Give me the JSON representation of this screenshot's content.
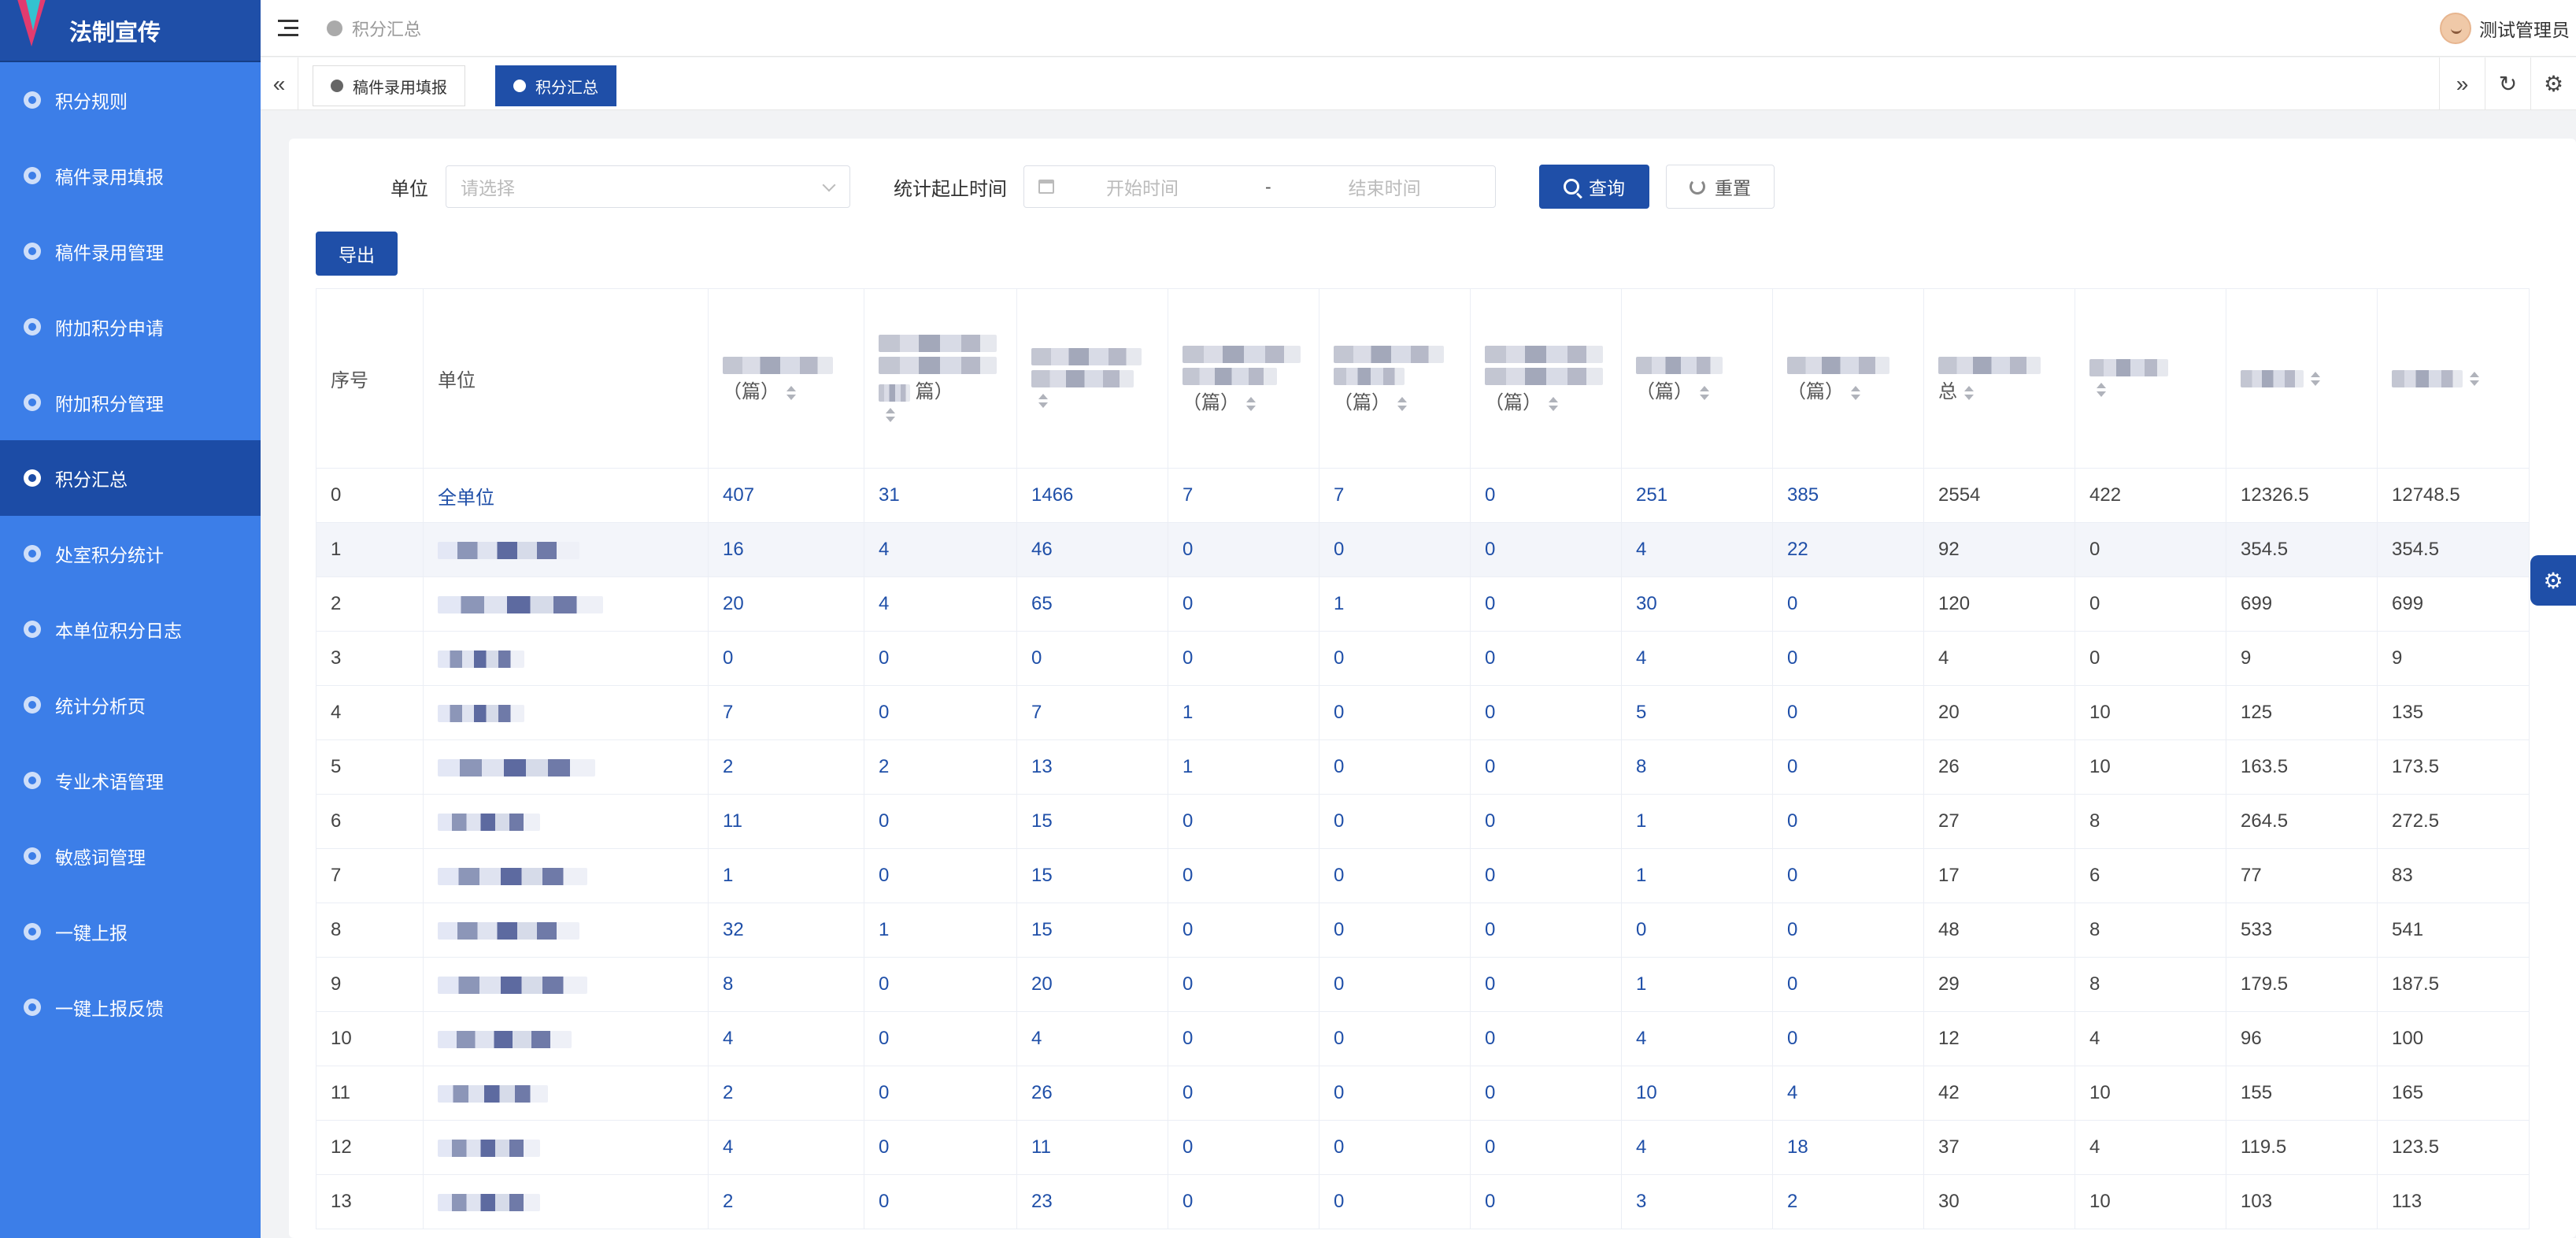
{
  "app": {
    "title": "法制宣传"
  },
  "sidebar": {
    "items": [
      {
        "label": "积分规则",
        "active": false
      },
      {
        "label": "稿件录用填报",
        "active": false
      },
      {
        "label": "稿件录用管理",
        "active": false
      },
      {
        "label": "附加积分申请",
        "active": false
      },
      {
        "label": "附加积分管理",
        "active": false
      },
      {
        "label": "积分汇总",
        "active": true
      },
      {
        "label": "处室积分统计",
        "active": false
      },
      {
        "label": "本单位积分日志",
        "active": false
      },
      {
        "label": "统计分析页",
        "active": false
      },
      {
        "label": "专业术语管理",
        "active": false
      },
      {
        "label": "敏感词管理",
        "active": false
      },
      {
        "label": "一键上报",
        "active": false
      },
      {
        "label": "一键上报反馈",
        "active": false
      }
    ]
  },
  "header": {
    "breadcrumb": "积分汇总",
    "user_name": "测试管理员"
  },
  "tabs": [
    {
      "label": "稿件录用填报",
      "active": false
    },
    {
      "label": "积分汇总",
      "active": true
    }
  ],
  "filters": {
    "unit_label": "单位",
    "unit_placeholder": "请选择",
    "date_label": "统计起止时间",
    "start_placeholder": "开始时间",
    "separator": "-",
    "end_placeholder": "结束时间",
    "query_label": "查询",
    "reset_label": "重置",
    "export_label": "导出"
  },
  "table": {
    "headers": {
      "index": "序号",
      "unit": "单位",
      "c1": "（篇）",
      "c2": "篇）",
      "c4": "（篇）",
      "c5": "（篇）",
      "c6": "（篇）",
      "c7": "（篇）",
      "c8": "（篇）",
      "c9": "总"
    },
    "rows": [
      {
        "idx": "0",
        "unit": "全单位",
        "v": [
          "407",
          "31",
          "1466",
          "7",
          "7",
          "0",
          "251",
          "385",
          "2554",
          "422",
          "12326.5",
          "12748.5"
        ]
      },
      {
        "idx": "1",
        "unit": "",
        "v": [
          "16",
          "4",
          "46",
          "0",
          "0",
          "0",
          "4",
          "22",
          "92",
          "0",
          "354.5",
          "354.5"
        ]
      },
      {
        "idx": "2",
        "unit": "",
        "v": [
          "20",
          "4",
          "65",
          "0",
          "1",
          "0",
          "30",
          "0",
          "120",
          "0",
          "699",
          "699"
        ]
      },
      {
        "idx": "3",
        "unit": "",
        "v": [
          "0",
          "0",
          "0",
          "0",
          "0",
          "0",
          "4",
          "0",
          "4",
          "0",
          "9",
          "9"
        ]
      },
      {
        "idx": "4",
        "unit": "",
        "v": [
          "7",
          "0",
          "7",
          "1",
          "0",
          "0",
          "5",
          "0",
          "20",
          "10",
          "125",
          "135"
        ]
      },
      {
        "idx": "5",
        "unit": "",
        "v": [
          "2",
          "2",
          "13",
          "1",
          "0",
          "0",
          "8",
          "0",
          "26",
          "10",
          "163.5",
          "173.5"
        ]
      },
      {
        "idx": "6",
        "unit": "",
        "v": [
          "11",
          "0",
          "15",
          "0",
          "0",
          "0",
          "1",
          "0",
          "27",
          "8",
          "264.5",
          "272.5"
        ]
      },
      {
        "idx": "7",
        "unit": "",
        "v": [
          "1",
          "0",
          "15",
          "0",
          "0",
          "0",
          "1",
          "0",
          "17",
          "6",
          "77",
          "83"
        ]
      },
      {
        "idx": "8",
        "unit": "",
        "v": [
          "32",
          "1",
          "15",
          "0",
          "0",
          "0",
          "0",
          "0",
          "48",
          "8",
          "533",
          "541"
        ]
      },
      {
        "idx": "9",
        "unit": "",
        "v": [
          "8",
          "0",
          "20",
          "0",
          "0",
          "0",
          "1",
          "0",
          "29",
          "8",
          "179.5",
          "187.5"
        ]
      },
      {
        "idx": "10",
        "unit": "",
        "v": [
          "4",
          "0",
          "4",
          "0",
          "0",
          "0",
          "4",
          "0",
          "12",
          "4",
          "96",
          "100"
        ]
      },
      {
        "idx": "11",
        "unit": "",
        "v": [
          "2",
          "0",
          "26",
          "0",
          "0",
          "0",
          "10",
          "4",
          "42",
          "10",
          "155",
          "165"
        ]
      },
      {
        "idx": "12",
        "unit": "",
        "v": [
          "4",
          "0",
          "11",
          "0",
          "0",
          "0",
          "4",
          "18",
          "37",
          "4",
          "119.5",
          "123.5"
        ]
      },
      {
        "idx": "13",
        "unit": "",
        "v": [
          "2",
          "0",
          "23",
          "0",
          "0",
          "0",
          "3",
          "2",
          "30",
          "10",
          "103",
          "113"
        ]
      }
    ]
  },
  "colors": {
    "primary": "#1f4fa8",
    "sidebar": "#3c7ee8",
    "link": "#1f4fa8"
  }
}
